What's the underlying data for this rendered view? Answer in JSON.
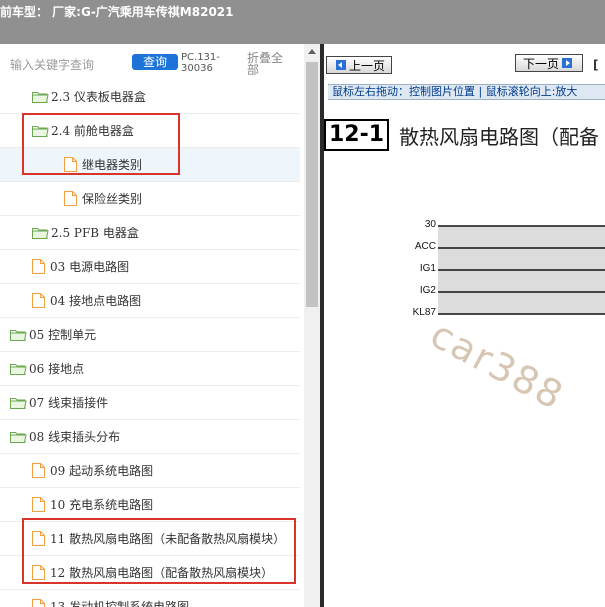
{
  "window": {
    "title": "前车型：  厂家:G-广汽乘用车传祺M82021"
  },
  "search": {
    "placeholder": "输入关键字查询",
    "button_label": "查询",
    "pc_code": "PC.131-30036",
    "collapse_label": "折叠全部"
  },
  "tree": [
    {
      "label": "2.3 仪表板电器盒",
      "kind": "folder",
      "level": 2
    },
    {
      "label": "2.4 前舱电器盒",
      "kind": "folder",
      "level": 2
    },
    {
      "label": "继电器类别",
      "kind": "file",
      "level": 3,
      "selected": true
    },
    {
      "label": "保险丝类别",
      "kind": "file",
      "level": 3
    },
    {
      "label": "2.5 PFB 电器盒",
      "kind": "folder",
      "level": 2
    },
    {
      "label": "03 电源电路图",
      "kind": "file",
      "level": 2
    },
    {
      "label": "04 接地点电路图",
      "kind": "file",
      "level": 2
    },
    {
      "label": "05 控制单元",
      "kind": "folder",
      "level": 1
    },
    {
      "label": "06 接地点",
      "kind": "folder",
      "level": 1
    },
    {
      "label": "07 线束插接件",
      "kind": "folder",
      "level": 1
    },
    {
      "label": "08 线束插头分布",
      "kind": "folder",
      "level": 1
    },
    {
      "label": "09 起动系统电路图",
      "kind": "file",
      "level": 2
    },
    {
      "label": "10 充电系统电路图",
      "kind": "file",
      "level": 2
    },
    {
      "label": "11 散热风扇电路图（未配备散热风扇模块）",
      "kind": "file",
      "level": 2
    },
    {
      "label": "12 散热风扇电路图（配备散热风扇模块）",
      "kind": "file",
      "level": 2
    },
    {
      "label": "13 发动机控制系统电路图",
      "kind": "file",
      "level": 2
    }
  ],
  "viewer": {
    "prev_label": "上一页",
    "next_label": "下一页",
    "nav_extra": "[",
    "hint": "鼠标左右拖动：控制图片位置 | 鼠标滚轮向上:放大",
    "figure_number": "12-1",
    "figure_title": "散热风扇电路图（配备",
    "signal_labels": [
      "30",
      "ACC",
      "IG1",
      "IG2",
      "KL87"
    ],
    "watermark": "car388"
  },
  "colors": {
    "title_bar": "#909090",
    "query_button": "#1e73d8",
    "folder": "#6aa84f",
    "file": "#f0a040",
    "highlight": "#d9342b"
  }
}
